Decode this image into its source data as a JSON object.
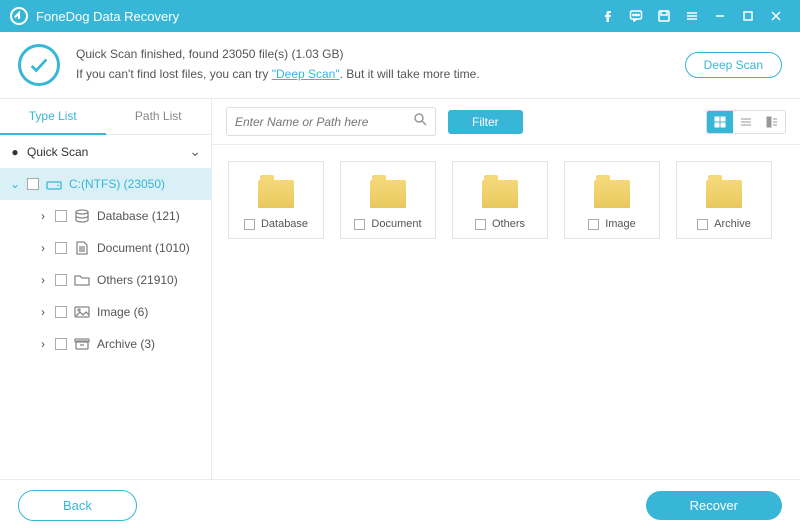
{
  "app": {
    "title": "FoneDog Data Recovery"
  },
  "banner": {
    "line1": "Quick Scan finished, found 23050 file(s) (1.03 GB)",
    "line2a": "If you can't find lost files, you can try ",
    "deep_link": "\"Deep Scan\"",
    "line2b": ". But it will take more time.",
    "deep_scan_btn": "Deep Scan"
  },
  "tabs": {
    "type": "Type List",
    "path": "Path List"
  },
  "tree": {
    "root": "Quick Scan",
    "drive": "C:(NTFS) (23050)",
    "items": [
      {
        "label": "Database (121)",
        "icon": "db"
      },
      {
        "label": "Document (1010)",
        "icon": "doc"
      },
      {
        "label": "Others (21910)",
        "icon": "folder"
      },
      {
        "label": "Image (6)",
        "icon": "image"
      },
      {
        "label": "Archive (3)",
        "icon": "archive"
      }
    ]
  },
  "toolbar": {
    "search_placeholder": "Enter Name or Path here",
    "filter": "Filter"
  },
  "grid": [
    {
      "name": "Database"
    },
    {
      "name": "Document"
    },
    {
      "name": "Others"
    },
    {
      "name": "Image"
    },
    {
      "name": "Archive"
    }
  ],
  "footer": {
    "back": "Back",
    "recover": "Recover"
  }
}
